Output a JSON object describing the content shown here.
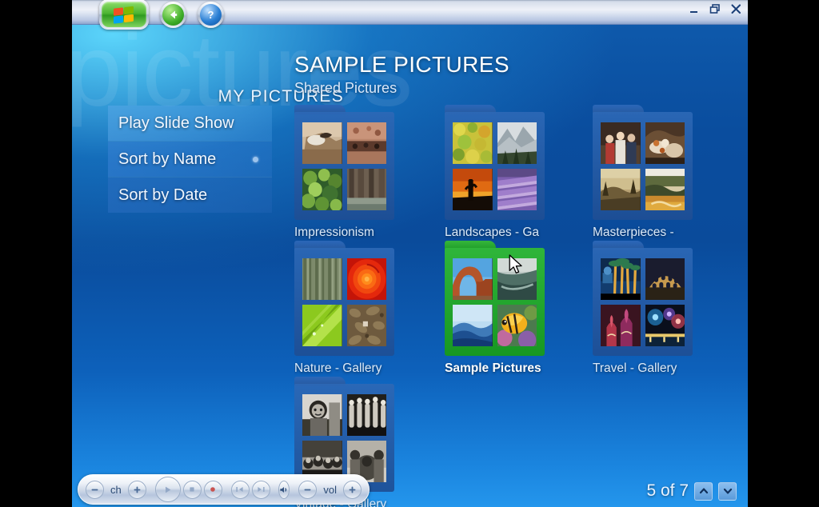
{
  "window": {
    "controls": {
      "minimize": "Minimize",
      "restore": "Restore",
      "close": "Close"
    },
    "logo": "windows-logo-icon",
    "back": "back-arrow-icon",
    "help": "help-question-icon"
  },
  "header": {
    "watermark": "pictures",
    "context_label": "MY PICTURES",
    "title": "SAMPLE PICTURES",
    "subtitle": "Shared Pictures"
  },
  "menu": {
    "items": [
      {
        "label": "Play Slide Show",
        "selected": false
      },
      {
        "label": "Sort by Name",
        "selected": true
      },
      {
        "label": "Sort by Date",
        "selected": false
      }
    ]
  },
  "grid": {
    "rows": [
      [
        {
          "label": "Impressionism",
          "selected": false
        },
        {
          "label": "Landscapes - Ga",
          "selected": false
        },
        {
          "label": "Masterpieces - ",
          "selected": false
        }
      ],
      [
        {
          "label": "Nature - Gallery",
          "selected": false
        },
        {
          "label": "Sample Pictures",
          "selected": true
        },
        {
          "label": "Travel - Gallery",
          "selected": false
        }
      ],
      [
        {
          "label": "Vintage - Gallery",
          "selected": false
        }
      ]
    ]
  },
  "transport": {
    "channel_down": "−",
    "channel_label": "ch",
    "channel_up": "+",
    "play": "play-icon",
    "stop": "stop-icon",
    "record": "record-icon",
    "previous": "skip-back-icon",
    "next": "skip-forward-icon",
    "mute": "mute-icon",
    "volume_down": "−",
    "volume_label": "vol",
    "volume_up": "+"
  },
  "pager": {
    "count_text": "5 of 7",
    "up": "chevron-up-icon",
    "down": "chevron-down-icon"
  },
  "colors": {
    "selection_green": "#2fb53a",
    "folder_blue": "#2c68b6",
    "background_blue": "#0a4d9e",
    "accent_cyan": "#60dcff"
  }
}
